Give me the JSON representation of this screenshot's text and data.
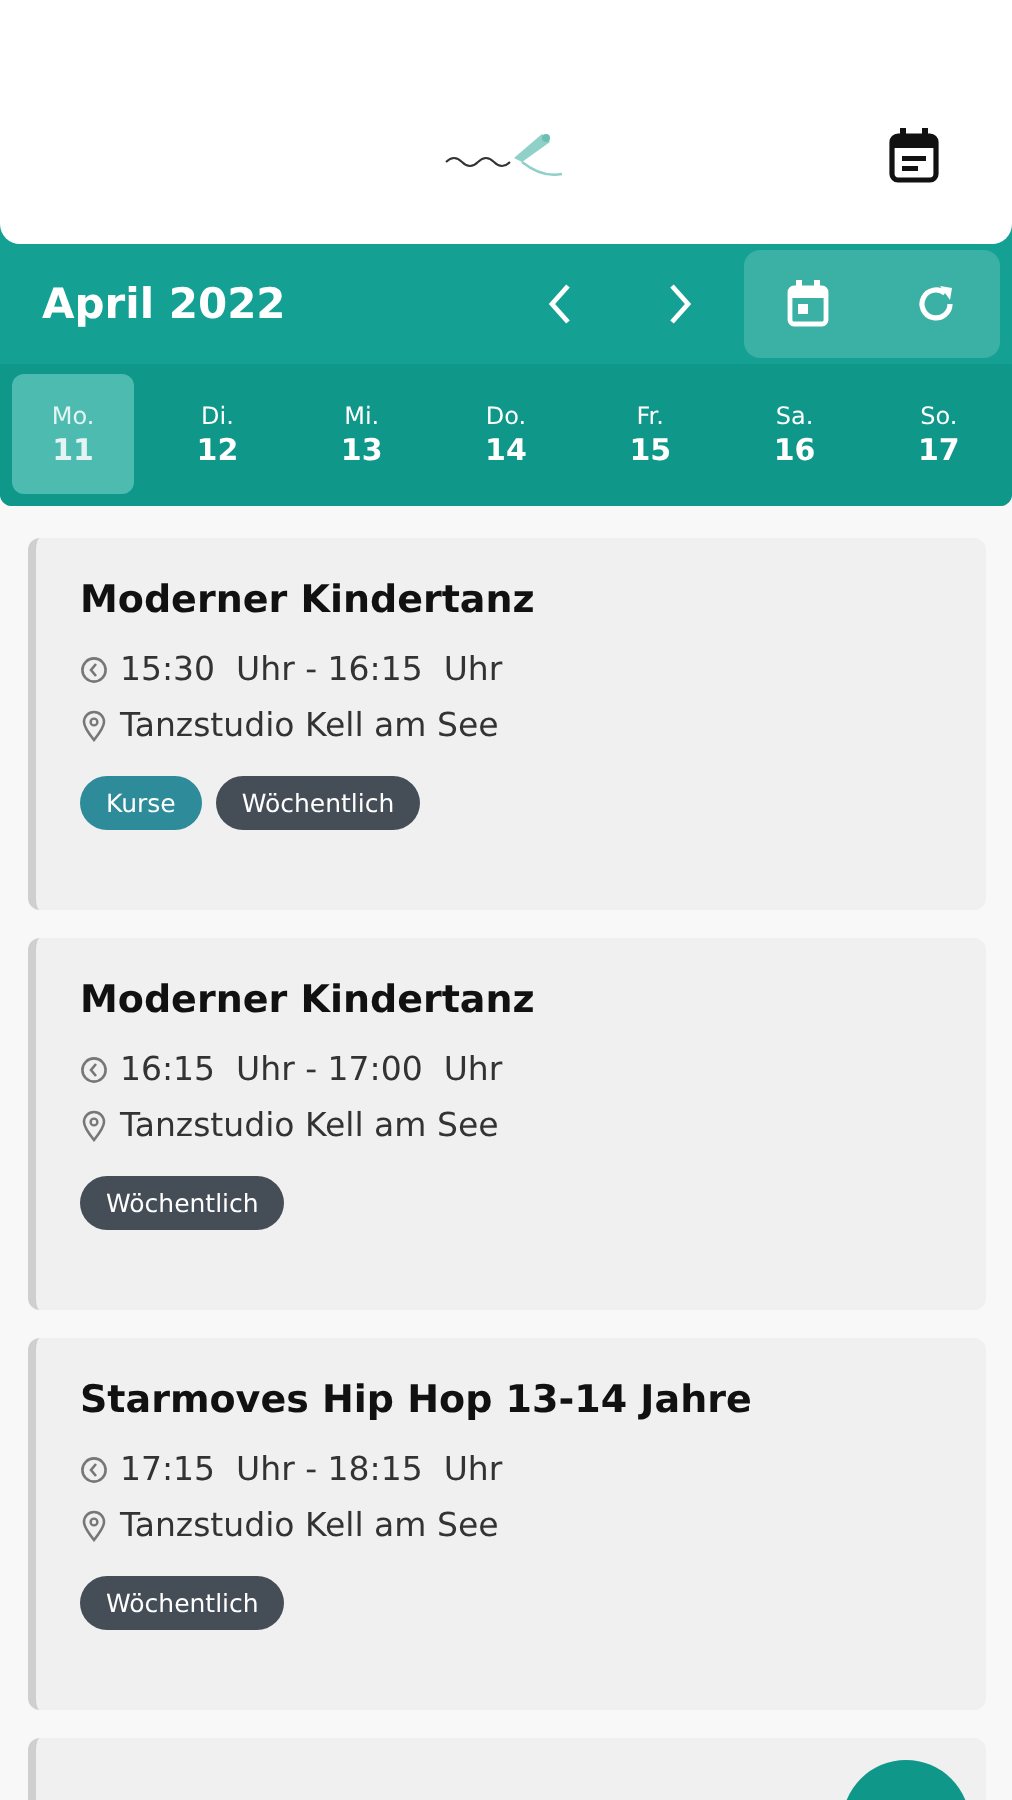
{
  "calendar": {
    "month": "April 2022",
    "days": [
      {
        "weekday": "Mo.",
        "date": "11",
        "selected": true
      },
      {
        "weekday": "Di.",
        "date": "12",
        "selected": false
      },
      {
        "weekday": "Mi.",
        "date": "13",
        "selected": false
      },
      {
        "weekday": "Do.",
        "date": "14",
        "selected": false
      },
      {
        "weekday": "Fr.",
        "date": "15",
        "selected": false
      },
      {
        "weekday": "Sa.",
        "date": "16",
        "selected": false
      },
      {
        "weekday": "So.",
        "date": "17",
        "selected": false
      }
    ]
  },
  "events": [
    {
      "title": "Moderner Kindertanz",
      "time": "15:30  Uhr - 16:15  Uhr",
      "location": "Tanzstudio Kell am See",
      "tags": [
        {
          "label": "Kurse",
          "color": "#2e8c9a"
        },
        {
          "label": "Wöchentlich",
          "color": "#454d57"
        }
      ]
    },
    {
      "title": "Moderner Kindertanz",
      "time": "16:15  Uhr - 17:00  Uhr",
      "location": "Tanzstudio Kell am See",
      "tags": [
        {
          "label": "Wöchentlich",
          "color": "#454d57"
        }
      ]
    },
    {
      "title": "Starmoves Hip Hop 13-14 Jahre",
      "time": "17:15  Uhr - 18:15  Uhr",
      "location": "Tanzstudio Kell am See",
      "tags": [
        {
          "label": "Wöchentlich",
          "color": "#454d57"
        }
      ]
    }
  ],
  "more_events_below": true
}
